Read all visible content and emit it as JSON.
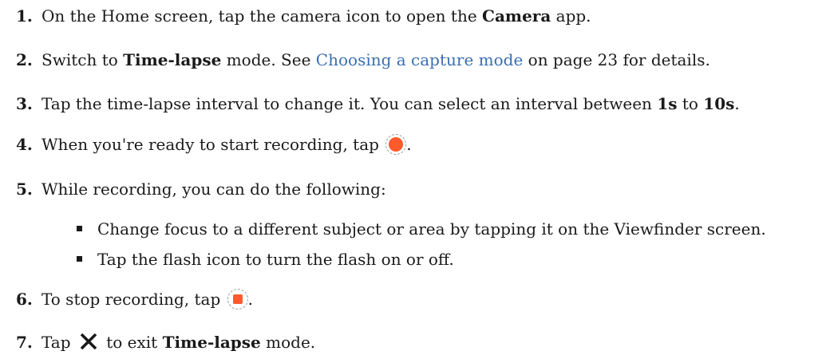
{
  "steps": [
    {
      "num": "1.",
      "a": "On the Home screen, tap the camera icon to open the ",
      "b": "Camera",
      "c": " app."
    },
    {
      "num": "2.",
      "a": "Switch to ",
      "b": "Time-lapse",
      "c": " mode. See ",
      "link": "Choosing a capture mode",
      "d": " on page 23 for details."
    },
    {
      "num": "3.",
      "a": "Tap the time-lapse interval to change it. You can select an interval between ",
      "b": "1s",
      "c": " to ",
      "d": "10s",
      "e": "."
    },
    {
      "num": "4.",
      "a": "When you're ready to start recording, tap ",
      "c": "."
    },
    {
      "num": "5.",
      "a": "While recording, you can do the following:"
    },
    {
      "num": "6.",
      "a": "To stop recording, tap ",
      "c": "."
    },
    {
      "num": "7.",
      "a": "Tap ",
      "c": " to exit ",
      "b": "Time-lapse",
      "d": " mode."
    }
  ],
  "sub_bullets": [
    "Change focus to a different subject or area by tapping it on the Viewfinder screen.",
    "Tap the flash icon to turn the flash on or off."
  ],
  "colors": {
    "link": "#3a6fb0",
    "record_icon": "#ff5a2b"
  }
}
